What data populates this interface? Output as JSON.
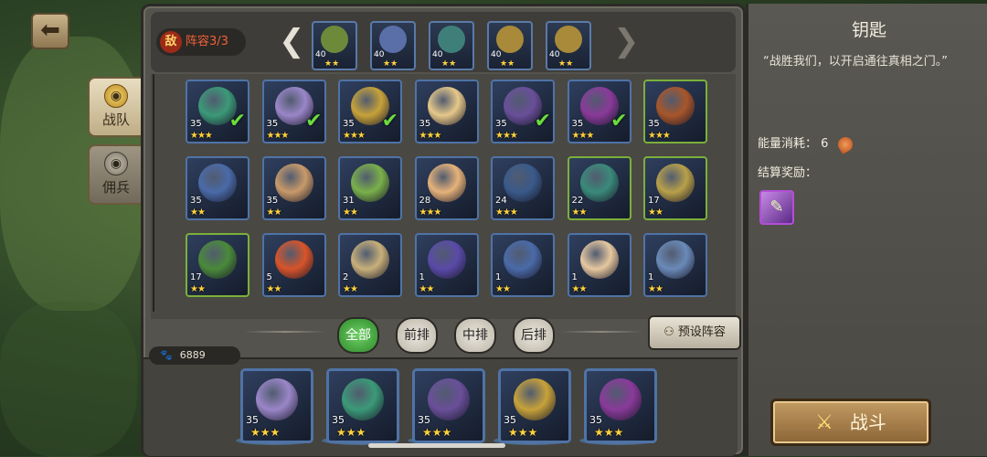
{
  "nav": {
    "back_icon": "back-arrow-icon"
  },
  "side_tabs": [
    {
      "label": "战队",
      "icon": "helmet-gold-icon"
    },
    {
      "label": "佣兵",
      "icon": "helmet-grey-icon"
    }
  ],
  "enemy_lineup": {
    "badge_mark": "敌",
    "label": "阵容3/3",
    "prev_arrow": "❮",
    "next_arrow": "❯",
    "members": [
      {
        "level": "40",
        "stars": "★★",
        "color": "#6d8a3a"
      },
      {
        "level": "40",
        "stars": "★★",
        "color": "#5a6ea8"
      },
      {
        "level": "40",
        "stars": "★★",
        "color": "#3f7f7a"
      },
      {
        "level": "40",
        "stars": "★★",
        "color": "#a88a3a"
      },
      {
        "level": "40",
        "stars": "★★",
        "color": "#a88a3a"
      }
    ]
  },
  "heroes": [
    {
      "level": "35",
      "stars": "★★★",
      "checked": true,
      "frame": "blue",
      "color": "#3b9a78"
    },
    {
      "level": "35",
      "stars": "★★★",
      "checked": true,
      "frame": "blue",
      "color": "#9a86c8"
    },
    {
      "level": "35",
      "stars": "★★★",
      "checked": true,
      "frame": "blue",
      "color": "#c7a23a"
    },
    {
      "level": "35",
      "stars": "★★★",
      "checked": false,
      "frame": "blue",
      "color": "#e6c88a"
    },
    {
      "level": "35",
      "stars": "★★★",
      "checked": true,
      "frame": "blue",
      "color": "#6a4f9a"
    },
    {
      "level": "35",
      "stars": "★★★",
      "checked": true,
      "frame": "blue",
      "color": "#8a3a9a"
    },
    {
      "level": "35",
      "stars": "★★★",
      "checked": false,
      "frame": "green",
      "color": "#a8562a"
    },
    {
      "level": "35",
      "stars": "★★",
      "checked": false,
      "frame": "blue",
      "color": "#4a6aa8"
    },
    {
      "level": "35",
      "stars": "★★",
      "checked": false,
      "frame": "blue",
      "color": "#c89a6a"
    },
    {
      "level": "31",
      "stars": "★★",
      "checked": false,
      "frame": "blue",
      "color": "#7ab04a"
    },
    {
      "level": "28",
      "stars": "★★★",
      "checked": false,
      "frame": "blue",
      "color": "#e6b27a"
    },
    {
      "level": "24",
      "stars": "★★★",
      "checked": false,
      "frame": "blue",
      "color": "#3a5a8a"
    },
    {
      "level": "22",
      "stars": "★★",
      "checked": false,
      "frame": "green",
      "color": "#3a8a7a"
    },
    {
      "level": "17",
      "stars": "★★",
      "checked": false,
      "frame": "green",
      "color": "#b8a04a"
    },
    {
      "level": "17",
      "stars": "★★",
      "checked": false,
      "frame": "green",
      "color": "#4a8a3a"
    },
    {
      "level": "5",
      "stars": "★★",
      "checked": false,
      "frame": "blue",
      "color": "#d8542a"
    },
    {
      "level": "2",
      "stars": "★★",
      "checked": false,
      "frame": "blue",
      "color": "#c8b07a"
    },
    {
      "level": "1",
      "stars": "★★",
      "checked": false,
      "frame": "blue",
      "color": "#5a4aa8"
    },
    {
      "level": "1",
      "stars": "★★",
      "checked": false,
      "frame": "blue",
      "color": "#4a6aa8"
    },
    {
      "level": "1",
      "stars": "★★",
      "checked": false,
      "frame": "blue",
      "color": "#e6c8a0"
    },
    {
      "level": "1",
      "stars": "★★",
      "checked": false,
      "frame": "blue",
      "color": "#6a8ab8"
    }
  ],
  "filters": {
    "all": "全部",
    "front": "前排",
    "middle": "中排",
    "back": "后排",
    "active": "all"
  },
  "preset": {
    "label": "预设阵容",
    "icon": "group-icon"
  },
  "power": {
    "icon": "paw-icon",
    "value": "6889"
  },
  "team": [
    {
      "level": "35",
      "stars": "★★★",
      "color": "#9a86c8"
    },
    {
      "level": "35",
      "stars": "★★★",
      "color": "#3b9a78"
    },
    {
      "level": "35",
      "stars": "★★★",
      "color": "#6a4f9a"
    },
    {
      "level": "35",
      "stars": "★★★",
      "color": "#c7a23a"
    },
    {
      "level": "35",
      "stars": "★★★",
      "color": "#8a3a9a"
    }
  ],
  "details": {
    "title": "钥匙",
    "quote": "“战胜我们，以开启通往真相之门。”",
    "energy_label": "能量消耗：",
    "energy_value": "6",
    "energy_icon": "meat-icon",
    "reward_label": "结算奖励：",
    "reward_icon": "scroll-icon"
  },
  "fight": {
    "label": "战斗",
    "icon": "crossed-swords-icon"
  }
}
